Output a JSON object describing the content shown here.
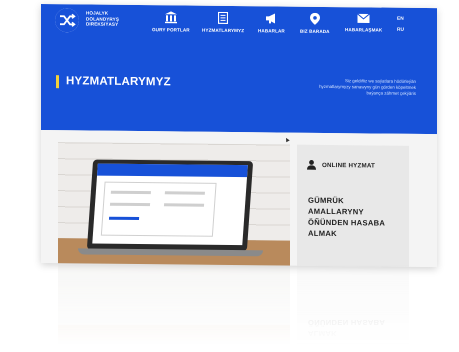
{
  "brand": {
    "name_lines": [
      "HOJALYK",
      "DOLANDYRYŞ",
      "DIREKSIÝASY"
    ],
    "logo_icon": "shuffle-arrows-icon"
  },
  "nav": [
    {
      "label": "GURY PORTLAR",
      "icon": "building-icon"
    },
    {
      "label": "HYZMATLARYMYZ",
      "icon": "document-icon"
    },
    {
      "label": "HABARLAR",
      "icon": "megaphone-icon"
    },
    {
      "label": "BIZ BARADA",
      "icon": "location-pin-icon"
    },
    {
      "label": "HABARLAŞMAK",
      "icon": "envelope-icon"
    }
  ],
  "languages": [
    "EN",
    "RU"
  ],
  "page": {
    "title": "HYZMATLARYMYZ",
    "description_lines": [
      "Siz geldiñiz we saýatlara hödürleýän",
      "hyzmatlarymyzy sanawyny gün görden köpeltmek",
      "baýança zähmet çekýäris"
    ]
  },
  "service_card": {
    "label": "ONLINE HYZMAT",
    "icon": "person-icon",
    "title_lines": [
      "GÜMRÜK",
      "AMALLARYNY",
      "ÖÑÜNDEN HASABA",
      "ALMAK"
    ]
  },
  "reflection_lines": [
    "ALMAK",
    "ÖÑÜNDEN HASABA"
  ],
  "colors": {
    "hero_blue": "#1751d8",
    "accent_yellow": "#f3d23a",
    "card_gray": "#e8e8e8"
  }
}
